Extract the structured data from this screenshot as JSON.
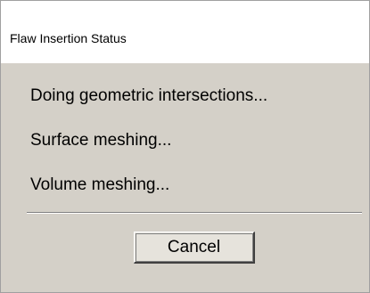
{
  "window": {
    "title": "Flaw Insertion Status"
  },
  "status": {
    "lines": [
      "Doing geometric intersections...",
      "Surface meshing...",
      "Volume meshing..."
    ]
  },
  "buttons": {
    "cancel_label": "Cancel"
  },
  "colors": {
    "dialog_background": "#d4d0c8",
    "title_background": "#ffffff"
  }
}
